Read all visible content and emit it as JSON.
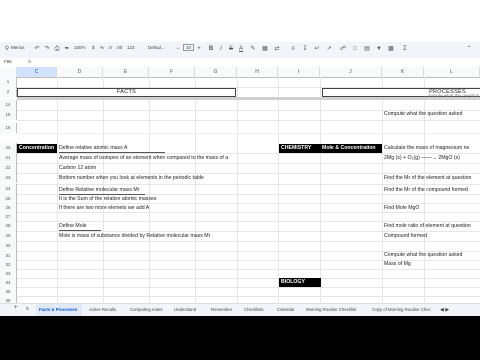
{
  "toolbar": {
    "zoom": "100%",
    "font": "Defaul...",
    "font_size": "10",
    "menus_label": "Menus",
    "currency": "$",
    "percent": "%",
    "decimal_dec": ".0",
    "decimal_inc": ".00",
    "num_format": "123"
  },
  "formula_bar": {
    "cell_ref": "F86"
  },
  "columns": [
    "C",
    "D",
    "E",
    "F",
    "G",
    "H",
    "I",
    "J",
    "K",
    "L"
  ],
  "rows": [
    "1",
    "2",
    "14",
    "15",
    "16",
    "20",
    "21",
    "22",
    "23",
    "24",
    "25",
    "26",
    "27",
    "28",
    "29",
    "30",
    "31",
    "32",
    "33",
    "34",
    "35",
    "36"
  ],
  "cells": {
    "facts_header": "FACTS",
    "processes_header": "PROCESSES",
    "r14_L": "...ompute what the question asked",
    "r15_K": "Compute what the question asked",
    "concentration": "Concentration",
    "r20_D": "Define relative atomic mass A",
    "r21_D": "Average mass of isotopes of an element when compared to the mass of a",
    "r22_D": "Carbon 12 atom",
    "r23_D": "Bottom number when you look at elements in the periodic table",
    "r25_D": "Define Relative molecular mass Mr",
    "r26_D": "It is the Sum of the relative atomic masses",
    "r27_D": "If there are two more elemets we add A",
    "r29_D": "Define Mole",
    "r30_D": "Mole is mass of substance divided by Relative molecular mass Mr",
    "chemistry": "CHEMISTRY",
    "mole_conc": "Mole & Concentration",
    "biology": "BIOLOGY",
    "r20_K": "Calculate the mass of magnesium ne",
    "r21_K": "2Mg (s) + O₂(g) ——→ 2MgO (s)",
    "r23_K": "Find the Mr of the element at question",
    "r25_K": "Find the Mr of the compound formed",
    "r27_K": "Find Mole MgO",
    "r29_K": "Find mole ratio of element at question",
    "r30_K": "Compound formed",
    "r32_K": "Compute what the question asked",
    "r33_K": "Mass of Mg"
  },
  "sheet_tabs": [
    {
      "label": "+",
      "active": false
    },
    {
      "label": "≡",
      "active": false
    },
    {
      "label": "Facts & Processes",
      "active": true
    },
    {
      "label": "Active Recalls",
      "active": false
    },
    {
      "label": "Computing notes",
      "active": false
    },
    {
      "label": "Understand",
      "active": false
    },
    {
      "label": "Remember",
      "active": false
    },
    {
      "label": "Checklists",
      "active": false
    },
    {
      "label": "Calendar",
      "active": false
    },
    {
      "label": "Morning Routine Checklist",
      "active": false
    },
    {
      "label": "Copy of Morning Routine Chec",
      "active": false
    }
  ],
  "colors": {
    "accent": "#0b57d0",
    "header_bg": "#f8f9fa",
    "black_cell": "#000000"
  }
}
